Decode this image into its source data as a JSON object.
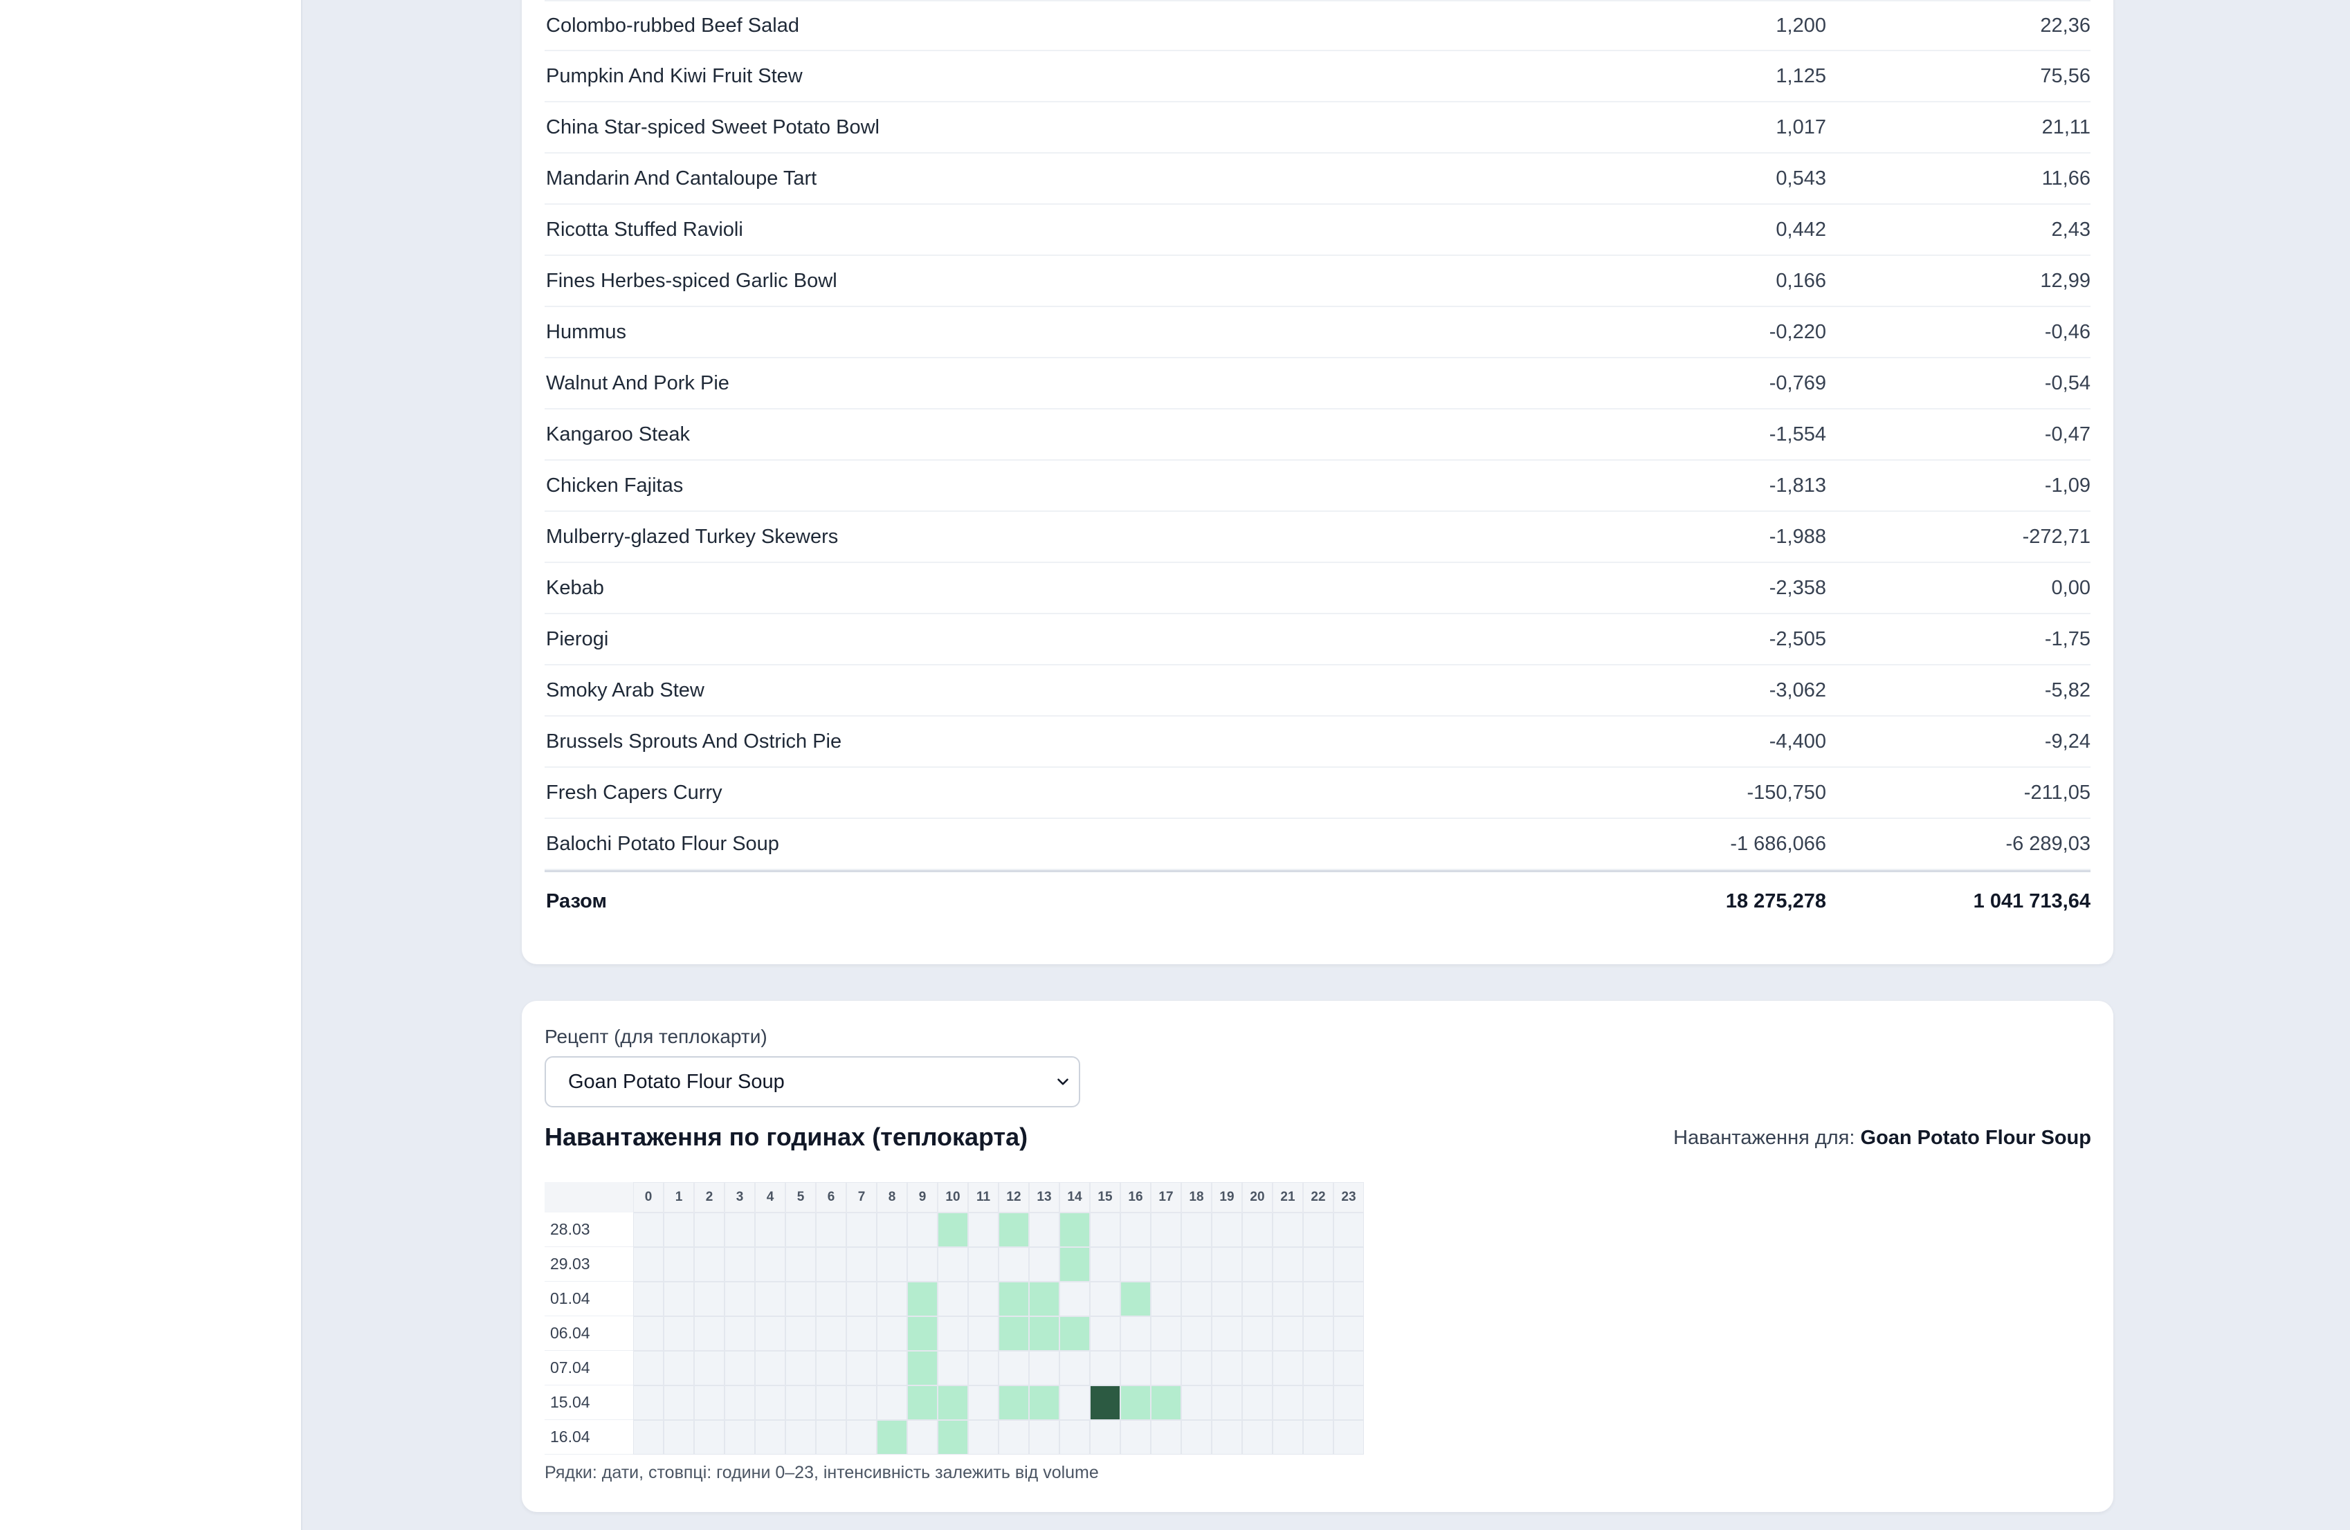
{
  "table": {
    "rows": [
      {
        "name": "Colombo-rubbed Beef Salad",
        "v1": "1,200",
        "v2": "22,36"
      },
      {
        "name": "Pumpkin And Kiwi Fruit Stew",
        "v1": "1,125",
        "v2": "75,56"
      },
      {
        "name": "China Star-spiced Sweet Potato Bowl",
        "v1": "1,017",
        "v2": "21,11"
      },
      {
        "name": "Mandarin And Cantaloupe Tart",
        "v1": "0,543",
        "v2": "11,66"
      },
      {
        "name": "Ricotta Stuffed Ravioli",
        "v1": "0,442",
        "v2": "2,43"
      },
      {
        "name": "Fines Herbes-spiced Garlic Bowl",
        "v1": "0,166",
        "v2": "12,99"
      },
      {
        "name": "Hummus",
        "v1": "-0,220",
        "v2": "-0,46"
      },
      {
        "name": "Walnut And Pork Pie",
        "v1": "-0,769",
        "v2": "-0,54"
      },
      {
        "name": "Kangaroo Steak",
        "v1": "-1,554",
        "v2": "-0,47"
      },
      {
        "name": "Chicken Fajitas",
        "v1": "-1,813",
        "v2": "-1,09"
      },
      {
        "name": "Mulberry-glazed Turkey Skewers",
        "v1": "-1,988",
        "v2": "-272,71"
      },
      {
        "name": "Kebab",
        "v1": "-2,358",
        "v2": "0,00"
      },
      {
        "name": "Pierogi",
        "v1": "-2,505",
        "v2": "-1,75"
      },
      {
        "name": "Smoky Arab Stew",
        "v1": "-3,062",
        "v2": "-5,82"
      },
      {
        "name": "Brussels Sprouts And Ostrich Pie",
        "v1": "-4,400",
        "v2": "-9,24"
      },
      {
        "name": "Fresh Capers Curry",
        "v1": "-150,750",
        "v2": "-211,05"
      },
      {
        "name": "Balochi Potato Flour Soup",
        "v1": "-1 686,066",
        "v2": "-6 289,03"
      }
    ],
    "total": {
      "label": "Разом",
      "v1": "18 275,278",
      "v2": "1 041 713,64"
    }
  },
  "heatmap": {
    "select_label": "Рецепт (для теплокарти)",
    "selected_recipe": "Goan Potato Flour Soup",
    "title": "Навантаження по годинах (теплокарта)",
    "for_label": "Навантаження для:",
    "for_value": "Goan Potato Flour Soup",
    "hours": [
      "0",
      "1",
      "2",
      "3",
      "4",
      "5",
      "6",
      "7",
      "8",
      "9",
      "10",
      "11",
      "12",
      "13",
      "14",
      "15",
      "16",
      "17",
      "18",
      "19",
      "20",
      "21",
      "22",
      "23"
    ],
    "dates": [
      "28.03",
      "29.03",
      "01.04",
      "06.04",
      "07.04",
      "15.04",
      "16.04"
    ],
    "intensity": [
      [
        0,
        0,
        0,
        0,
        0,
        0,
        0,
        0,
        0,
        0,
        1,
        0,
        1,
        0,
        1,
        0,
        0,
        0,
        0,
        0,
        0,
        0,
        0,
        0
      ],
      [
        0,
        0,
        0,
        0,
        0,
        0,
        0,
        0,
        0,
        0,
        0,
        0,
        0,
        0,
        1,
        0,
        0,
        0,
        0,
        0,
        0,
        0,
        0,
        0
      ],
      [
        0,
        0,
        0,
        0,
        0,
        0,
        0,
        0,
        0,
        1,
        0,
        0,
        1,
        1,
        0,
        0,
        1,
        0,
        0,
        0,
        0,
        0,
        0,
        0
      ],
      [
        0,
        0,
        0,
        0,
        0,
        0,
        0,
        0,
        0,
        1,
        0,
        0,
        1,
        1,
        1,
        0,
        0,
        0,
        0,
        0,
        0,
        0,
        0,
        0
      ],
      [
        0,
        0,
        0,
        0,
        0,
        0,
        0,
        0,
        0,
        1,
        0,
        0,
        0,
        0,
        0,
        0,
        0,
        0,
        0,
        0,
        0,
        0,
        0,
        0
      ],
      [
        0,
        0,
        0,
        0,
        0,
        0,
        0,
        0,
        0,
        1,
        1,
        0,
        1,
        1,
        0,
        5,
        1,
        1,
        0,
        0,
        0,
        0,
        0,
        0
      ],
      [
        0,
        0,
        0,
        0,
        0,
        0,
        0,
        0,
        1,
        0,
        1,
        0,
        0,
        0,
        0,
        0,
        0,
        0,
        0,
        0,
        0,
        0,
        0,
        0
      ]
    ],
    "caption": "Рядки: дати, стовпці: години 0–23, інтенсивність залежить від volume",
    "colors": {
      "empty": "#f1f4f8",
      "low": "#b4ecce",
      "high": "#2c5a42"
    }
  }
}
